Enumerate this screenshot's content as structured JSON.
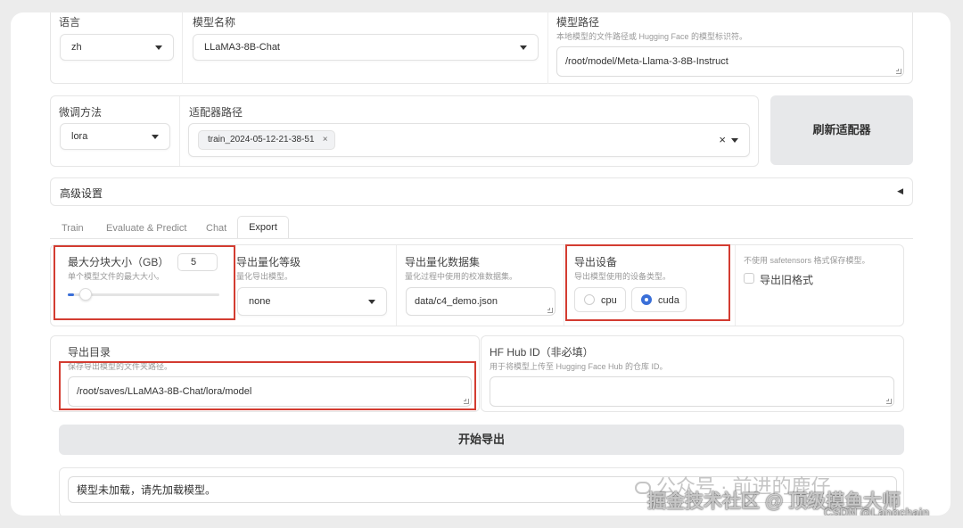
{
  "top": {
    "language": {
      "label": "语言",
      "value": "zh"
    },
    "model_name": {
      "label": "模型名称",
      "value": "LLaMA3-8B-Chat"
    },
    "model_path": {
      "label": "模型路径",
      "hint": "本地模型的文件路径或 Hugging Face 的模型标识符。",
      "value": "/root/model/Meta-Llama-3-8B-Instruct"
    }
  },
  "finetune": {
    "method": {
      "label": "微调方法",
      "value": "lora"
    },
    "adapter": {
      "label": "适配器路径",
      "tag": "train_2024-05-12-21-38-51",
      "tag_close": "×",
      "clear": "×"
    },
    "refresh_button": "刷新适配器"
  },
  "advanced": {
    "label": "高级设置",
    "toggle": "◀"
  },
  "tabs": [
    {
      "label": "Train",
      "active": false
    },
    {
      "label": "Evaluate & Predict",
      "active": false
    },
    {
      "label": "Chat",
      "active": false
    },
    {
      "label": "Export",
      "active": true
    }
  ],
  "export": {
    "shard_size": {
      "label": "最大分块大小（GB）",
      "hint": "单个模型文件的最大大小。",
      "value": "5",
      "slider_fraction": 0.04
    },
    "quant_bit": {
      "label": "导出量化等级",
      "hint": "量化导出模型。",
      "value": "none"
    },
    "quant_dataset": {
      "label": "导出量化数据集",
      "hint": "量化过程中使用的校准数据集。",
      "value": "data/c4_demo.json"
    },
    "device": {
      "label": "导出设备",
      "hint": "导出模型使用的设备类型。",
      "options": [
        "cpu",
        "cuda"
      ],
      "selected": "cuda"
    },
    "legacy": {
      "hint": "不使用 safetensors 格式保存模型。",
      "label": "导出旧格式",
      "checked": false
    },
    "export_dir": {
      "label": "导出目录",
      "hint": "保存导出模型的文件夹路径。",
      "value": "/root/saves/LLaMA3-8B-Chat/lora/model"
    },
    "hub_id": {
      "label": "HF Hub ID（非必填）",
      "hint": "用于将模型上传至 Hugging Face Hub 的仓库 ID。",
      "value": ""
    },
    "start_button": "开始导出",
    "info": "模型未加载，请先加载模型。"
  },
  "watermarks": {
    "wechat": "公众号 · 前进的鹿仔",
    "juejin": "掘金技术社区 @ 顶级摸鱼大师",
    "csdn": "CSDN @Langchain"
  },
  "colors": {
    "highlight": "#d33c31",
    "accent": "#3a6fd8"
  }
}
